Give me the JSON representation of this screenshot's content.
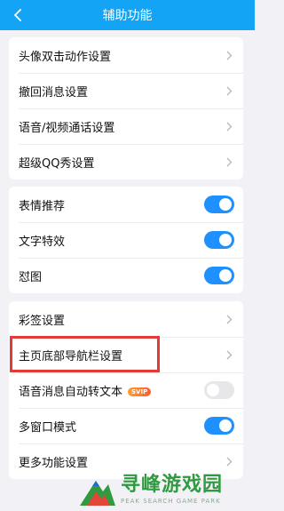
{
  "nav": {
    "title": "辅助功能"
  },
  "group1": {
    "items": [
      {
        "label": "头像双击动作设置"
      },
      {
        "label": "撤回消息设置"
      },
      {
        "label": "语音/视频通话设置"
      },
      {
        "label": "超级QQ秀设置"
      }
    ]
  },
  "group2": {
    "items": [
      {
        "label": "表情推荐",
        "enabled": true
      },
      {
        "label": "文字特效",
        "enabled": true
      },
      {
        "label": "怼图",
        "enabled": true
      }
    ]
  },
  "group3": {
    "items": [
      {
        "label": "彩签设置",
        "type": "link"
      },
      {
        "label": "主页底部导航栏设置",
        "type": "link"
      },
      {
        "label": "语音消息自动转文本",
        "type": "toggle",
        "enabled": false,
        "badge": "SVIP"
      },
      {
        "label": "多窗口模式",
        "type": "toggle",
        "enabled": true
      },
      {
        "label": "更多功能设置",
        "type": "link"
      }
    ]
  },
  "colors": {
    "nav_bg": "#14a4f5",
    "toggle_on": "#1e90ff",
    "highlight": "#e53935"
  },
  "watermark": {
    "cn": "寻峰游戏园",
    "en": "PEAK SEARCH GAME PARK"
  }
}
